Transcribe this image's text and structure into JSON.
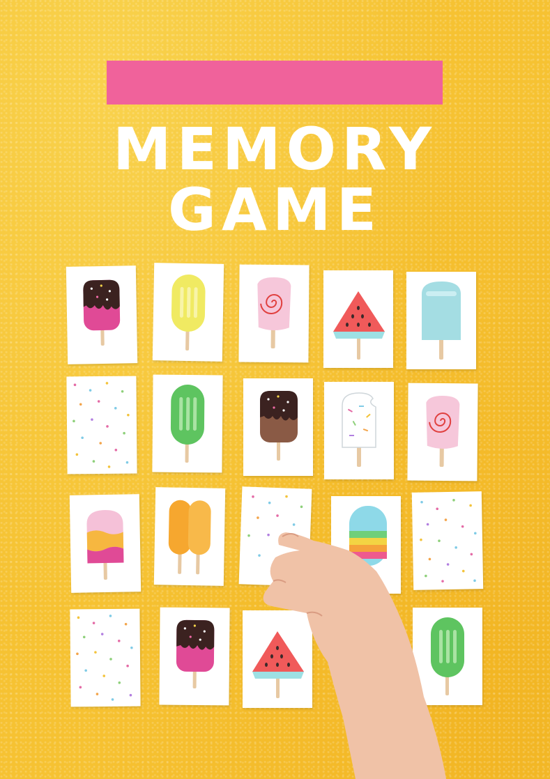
{
  "title": {
    "line1": "MEMORY",
    "line2": "GAME"
  },
  "colors": {
    "background": "#f6c232",
    "banner": "#f0629b",
    "title": "#ffffff",
    "card": "#ffffff"
  },
  "cards": [
    {
      "row": 1,
      "col": 1,
      "icon": "chocolate-sprinkle-popsicle-pink"
    },
    {
      "row": 1,
      "col": 2,
      "icon": "yellow-popsicle"
    },
    {
      "row": 1,
      "col": 3,
      "icon": "pink-swirl-popsicle"
    },
    {
      "row": 1,
      "col": 4,
      "icon": "watermelon-popsicle"
    },
    {
      "row": 1,
      "col": 5,
      "icon": "blue-popsicle"
    },
    {
      "row": 2,
      "col": 1,
      "icon": "confetti-card-back"
    },
    {
      "row": 2,
      "col": 2,
      "icon": "green-popsicle"
    },
    {
      "row": 2,
      "col": 3,
      "icon": "chocolate-sprinkle-popsicle-brown"
    },
    {
      "row": 2,
      "col": 4,
      "icon": "white-sprinkle-popsicle"
    },
    {
      "row": 2,
      "col": 5,
      "icon": "pink-swirl-popsicle"
    },
    {
      "row": 3,
      "col": 1,
      "icon": "layered-popsicle"
    },
    {
      "row": 3,
      "col": 2,
      "icon": "orange-double-popsicle"
    },
    {
      "row": 3,
      "col": 3,
      "icon": "confetti-card-back"
    },
    {
      "row": 3,
      "col": 4,
      "icon": "rainbow-popsicle"
    },
    {
      "row": 3,
      "col": 5,
      "icon": "confetti-card-back"
    },
    {
      "row": 4,
      "col": 1,
      "icon": "confetti-card-back"
    },
    {
      "row": 4,
      "col": 2,
      "icon": "chocolate-sprinkle-popsicle-pink"
    },
    {
      "row": 4,
      "col": 3,
      "icon": "watermelon-popsicle"
    },
    {
      "row": 4,
      "col": 5,
      "icon": "green-popsicle"
    }
  ]
}
